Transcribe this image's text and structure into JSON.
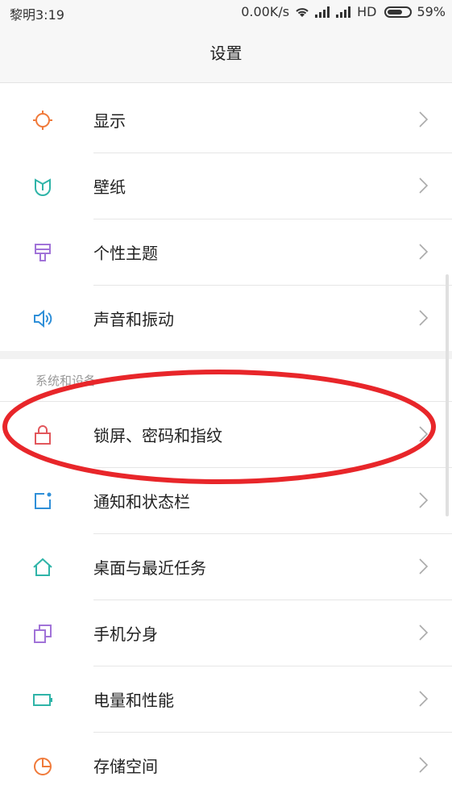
{
  "status": {
    "time": "黎明3:19",
    "speed": "0.00K/s",
    "network": "HD",
    "battery": "59%"
  },
  "header": {
    "title": "设置"
  },
  "group1": {
    "items": [
      {
        "label": "显示",
        "icon": "sun-icon"
      },
      {
        "label": "壁纸",
        "icon": "wallpaper-icon"
      },
      {
        "label": "个性主题",
        "icon": "theme-brush-icon"
      },
      {
        "label": "声音和振动",
        "icon": "speaker-icon"
      }
    ]
  },
  "group2": {
    "header": "系统和设备",
    "items": [
      {
        "label": "锁屏、密码和指纹",
        "icon": "lock-icon"
      },
      {
        "label": "通知和状态栏",
        "icon": "notification-icon"
      },
      {
        "label": "桌面与最近任务",
        "icon": "home-icon"
      },
      {
        "label": "手机分身",
        "icon": "dual-phone-icon"
      },
      {
        "label": "电量和性能",
        "icon": "battery-icon"
      },
      {
        "label": "存储空间",
        "icon": "storage-pie-icon"
      }
    ]
  },
  "colors": {
    "annotation_oval": "#e8262a"
  }
}
